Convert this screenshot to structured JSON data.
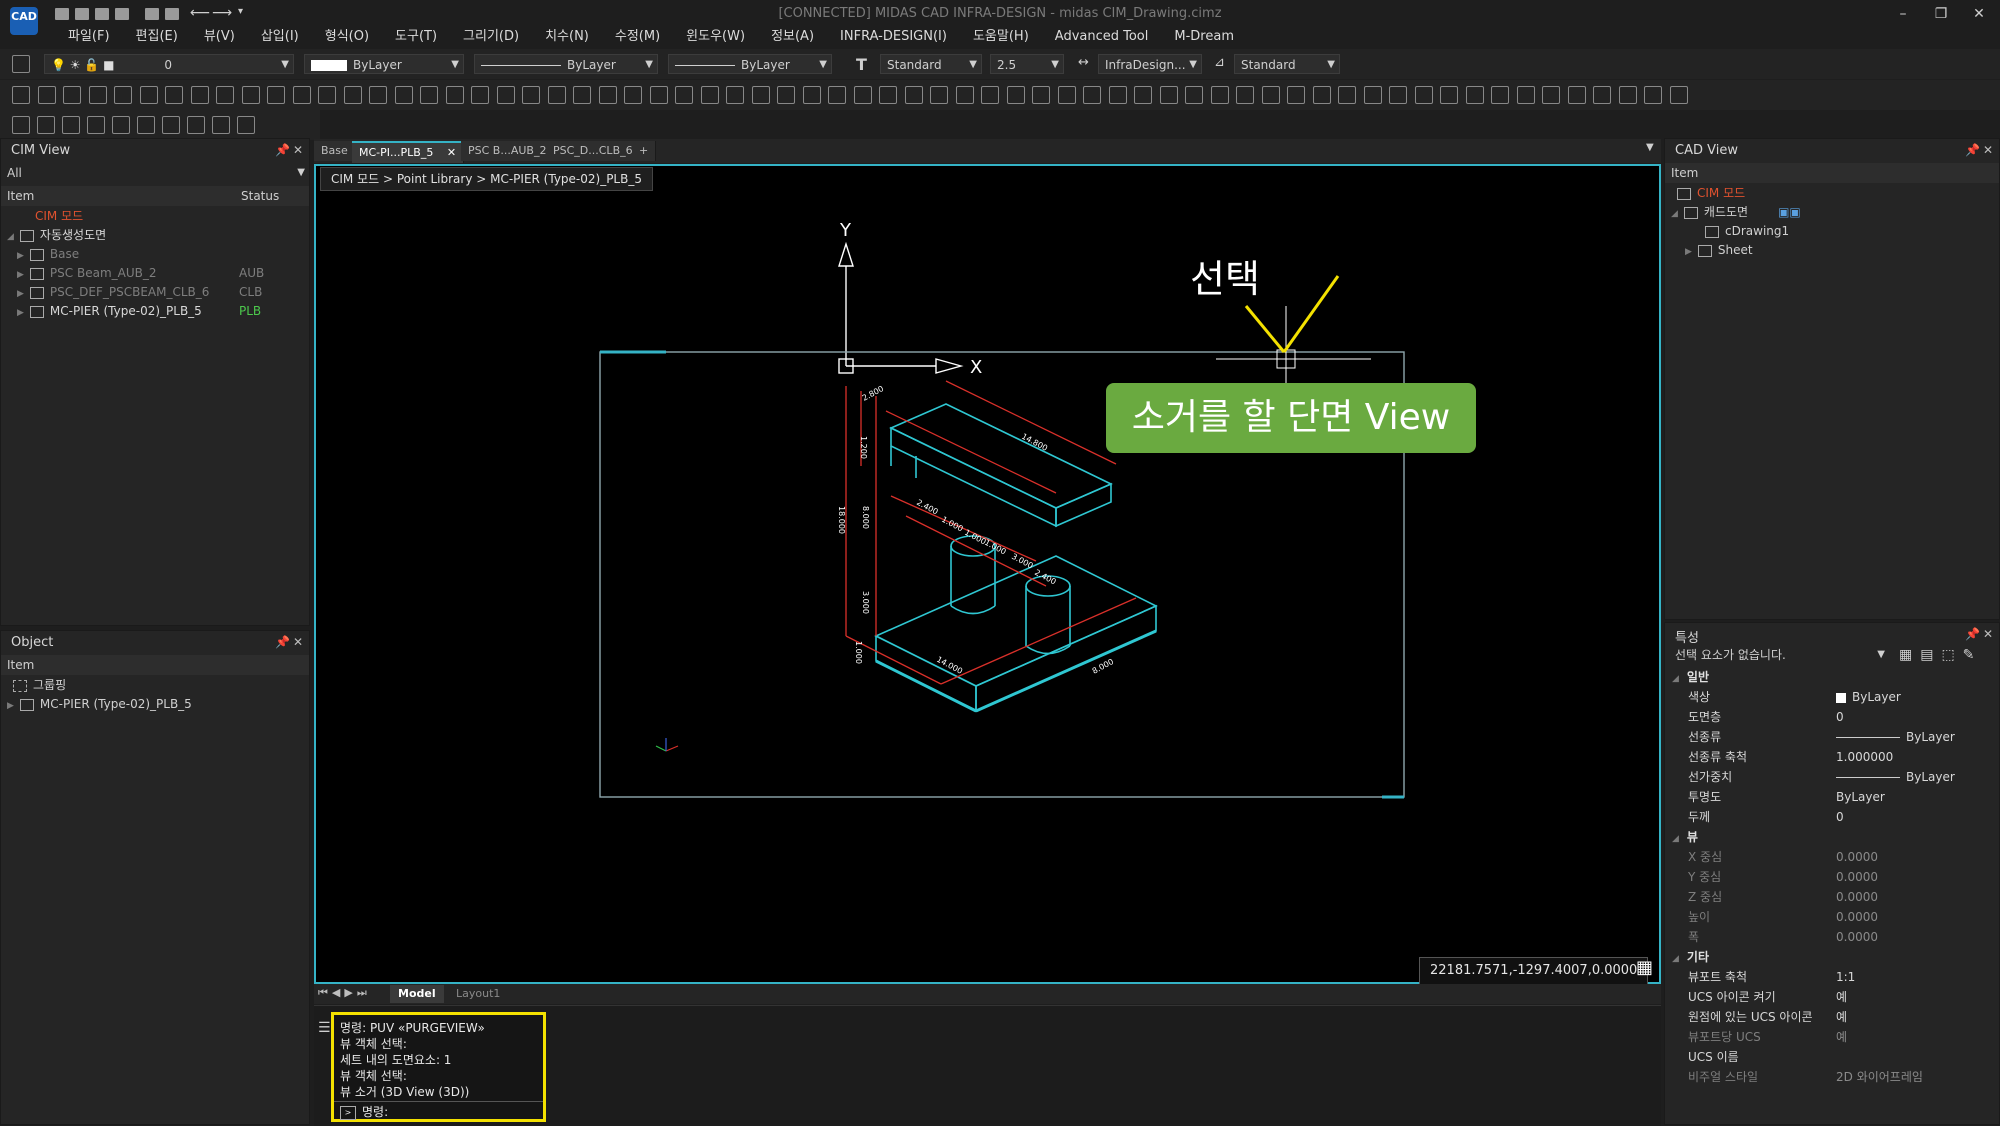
{
  "app": {
    "title": "[CONNECTED] MIDAS CAD INFRA-DESIGN - midas CIM_Drawing.cimz",
    "logo_text": "CAD",
    "window_controls": [
      "–",
      "❐",
      "✕"
    ]
  },
  "menu": [
    "파일(F)",
    "편집(E)",
    "뷰(V)",
    "삽입(I)",
    "형식(O)",
    "도구(T)",
    "그리기(D)",
    "치수(N)",
    "수정(M)",
    "윈도우(W)",
    "정보(A)",
    "INFRA-DESIGN(I)",
    "도움말(H)",
    "Advanced Tool",
    "M-Dream"
  ],
  "toolbar": {
    "layer_value": "0",
    "color_value": "ByLayer",
    "linetype_value": "ByLayer",
    "lineweight_value": "ByLayer",
    "textstyle_value": "Standard",
    "textsize_value": "2.5",
    "dimstyle_value": "InfraDesign...",
    "tablestyle_value": "Standard"
  },
  "cim_view": {
    "title": "CIM View",
    "filter": "All",
    "col_item": "Item",
    "col_status": "Status",
    "rows": [
      {
        "label": "CIM 모드",
        "status": "",
        "color": "#e0522f"
      },
      {
        "label": "자동생성도면",
        "status": "",
        "color": "#d8d8d8"
      },
      {
        "label": "Base",
        "status": "",
        "color": "#7e7e7e"
      },
      {
        "label": "PSC Beam_AUB_2",
        "status": "AUB",
        "color": "#7e7e7e"
      },
      {
        "label": "PSC_DEF_PSCBEAM_CLB_6",
        "status": "CLB",
        "color": "#7e7e7e"
      },
      {
        "label": "MC-PIER (Type-02)_PLB_5",
        "status": "PLB",
        "color": "#d8d8d8"
      }
    ]
  },
  "object_panel": {
    "title": "Object",
    "col_item": "Item",
    "rows": [
      "그룹핑",
      "MC-PIER (Type-02)_PLB_5"
    ]
  },
  "doc_tabs": [
    "Base",
    "MC-PI...PLB_5",
    "PSC B...AUB_2",
    "PSC_D...CLB_6"
  ],
  "breadcrumb": "CIM 모드 > Point Library > MC-PIER (Type-02)_PLB_5",
  "viewport": {
    "axis_x": "X",
    "axis_y": "Y",
    "dims": [
      "2.800",
      "1.200",
      "14.800",
      "2.400",
      "1.000",
      "1.000",
      "1.000",
      "3.000",
      "2.400",
      "18.000",
      "8.000",
      "3.000",
      "1.000",
      "14.000",
      "8.000"
    ],
    "coords": "22181.7571,-1297.4007,0.0000"
  },
  "annotation": {
    "select_label": "선택",
    "callout": "소거를 할 단면 View"
  },
  "layout_tabs": [
    "Model",
    "Layout1"
  ],
  "command": {
    "lines": [
      "명령: PUV «PURGEVIEW»",
      "뷰 객체 선택:",
      "세트 내의 도면요소: 1",
      "뷰 객체 선택:",
      "뷰 소거 (3D View (3D))"
    ],
    "prompt": "명령:"
  },
  "cad_view": {
    "title": "CAD View",
    "col_item": "Item",
    "rows": [
      {
        "label": "CIM 모드",
        "color": "#e0522f"
      },
      {
        "label": "캐드도면",
        "color": "#d8d8d8"
      },
      {
        "label": "cDrawing1",
        "color": "#d8d8d8"
      },
      {
        "label": "Sheet",
        "color": "#d8d8d8"
      }
    ]
  },
  "properties": {
    "title": "특성",
    "no_selection": "선택 요소가 없습니다.",
    "sections": {
      "general": "일반",
      "view": "뷰",
      "misc": "기타"
    },
    "general": [
      {
        "k": "색상",
        "v": "ByLayer"
      },
      {
        "k": "도면층",
        "v": "0"
      },
      {
        "k": "선종류",
        "v": "ByLayer"
      },
      {
        "k": "선종류 축척",
        "v": "1.000000"
      },
      {
        "k": "선가중치",
        "v": "ByLayer"
      },
      {
        "k": "투명도",
        "v": "ByLayer"
      },
      {
        "k": "두께",
        "v": "0"
      }
    ],
    "view": [
      {
        "k": "X 중심",
        "v": "0.0000"
      },
      {
        "k": "Y 중심",
        "v": "0.0000"
      },
      {
        "k": "Z 중심",
        "v": "0.0000"
      },
      {
        "k": "높이",
        "v": "0.0000"
      },
      {
        "k": "폭",
        "v": "0.0000"
      }
    ],
    "misc": [
      {
        "k": "뷰포트 축척",
        "v": "1:1"
      },
      {
        "k": "UCS 아이콘 켜기",
        "v": "예"
      },
      {
        "k": "원점에 있는 UCS 아이콘",
        "v": "예"
      },
      {
        "k": "뷰포트당 UCS",
        "v": "예"
      },
      {
        "k": "UCS 이름",
        "v": ""
      },
      {
        "k": "비주얼 스타일",
        "v": "2D 와이어프레임"
      }
    ]
  }
}
